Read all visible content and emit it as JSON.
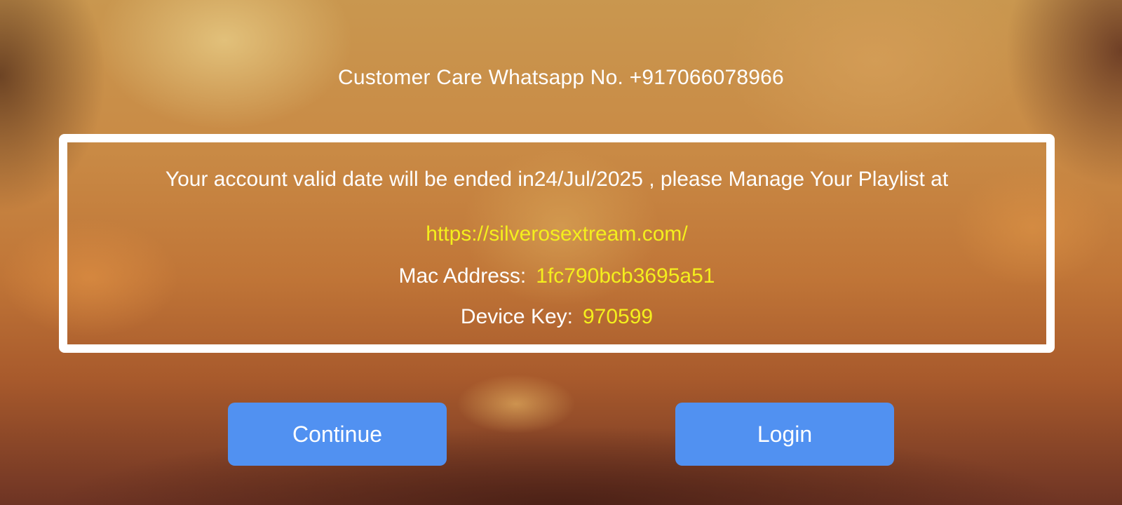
{
  "header": {
    "customer_care": "Customer Care Whatsapp No. +917066078966"
  },
  "info": {
    "message": "Your account valid date will be ended in24/Jul/2025 , please Manage Your Playlist at",
    "url": "https://silverosextream.com/",
    "mac_label": "Mac Address:",
    "mac_value": "1fc790bcb3695a51",
    "device_key_label": "Device Key:",
    "device_key_value": "970599"
  },
  "buttons": {
    "continue_label": "Continue",
    "login_label": "Login"
  },
  "colors": {
    "button": "#5191f1",
    "highlight": "#f4ef1d",
    "text": "#ffffff"
  }
}
